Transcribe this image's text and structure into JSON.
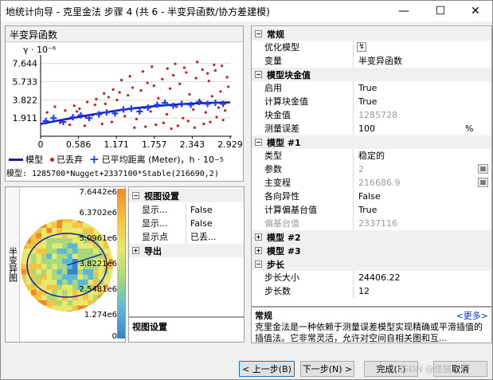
{
  "window": {
    "title": "地统计向导 - 克里金法 步骤 4 (共 6 - 半变异函数/协方差建模)",
    "minimize_glyph": "—",
    "maximize_glyph": "☐",
    "close_glyph": "✕"
  },
  "semivariogram": {
    "header": "半变异函数",
    "y_unit": "γ  · 10⁻⁶",
    "x_unit_suffix": "−5",
    "legend": {
      "model": "模型",
      "discarded": "已丢弃",
      "averaged": "已平均",
      "distance": "距离 (Meter)，h  · 10"
    },
    "model_text": "模型: 1285700*Nugget+2337100*Stable(216690,2)"
  },
  "chart_data": {
    "type": "scatter",
    "title": "",
    "xlabel": "",
    "ylabel": "",
    "xlim": [
      0,
      2.929
    ],
    "ylim": [
      0,
      8.2
    ],
    "x_ticks": [
      "0",
      "0.586",
      "1.171",
      "1.757",
      "2.343",
      "2.929"
    ],
    "y_ticks": [
      "1.911",
      "3.822",
      "5.733",
      "7.644"
    ],
    "series": [
      {
        "name": "已平均",
        "x": [
          0.08,
          0.2,
          0.35,
          0.5,
          0.62,
          0.75,
          0.9,
          1.02,
          1.15,
          1.28,
          1.4,
          1.53,
          1.66,
          1.8,
          1.92,
          2.05,
          2.18,
          2.32,
          2.45,
          2.58,
          2.7,
          2.82
        ],
        "y": [
          1.6,
          1.9,
          1.5,
          2.0,
          2.2,
          1.9,
          2.3,
          2.5,
          2.4,
          2.8,
          2.9,
          2.6,
          3.0,
          3.3,
          3.5,
          3.2,
          3.4,
          3.3,
          3.6,
          3.4,
          3.5,
          3.4
        ]
      },
      {
        "name": "模型",
        "x": [
          0,
          0.29,
          0.59,
          0.88,
          1.17,
          1.46,
          1.76,
          2.05,
          2.34,
          2.64,
          2.929
        ],
        "y": [
          1.29,
          1.66,
          2.03,
          2.38,
          2.69,
          2.95,
          3.16,
          3.32,
          3.43,
          3.51,
          3.56
        ]
      },
      {
        "name": "已丢弃",
        "x": [
          0.1,
          0.22,
          0.3,
          0.38,
          0.45,
          0.52,
          0.6,
          0.68,
          0.72,
          0.8,
          0.86,
          0.95,
          1.0,
          1.05,
          1.1,
          1.18,
          1.22,
          1.3,
          1.35,
          1.42,
          1.48,
          1.55,
          1.6,
          1.65,
          1.7,
          1.75,
          1.82,
          1.88,
          1.95,
          2.0,
          2.05,
          2.1,
          2.15,
          2.2,
          2.25,
          2.3,
          2.36,
          2.4,
          2.46,
          2.5,
          2.55,
          2.6,
          2.65,
          2.7,
          2.75,
          2.8,
          2.85,
          2.9,
          1.45,
          1.62,
          1.78,
          1.9,
          2.02,
          2.12,
          2.28,
          2.38,
          2.52,
          2.62,
          2.72,
          2.82,
          1.25,
          1.12,
          0.98,
          0.84,
          0.7,
          0.56,
          1.38,
          1.58,
          1.72,
          1.96,
          2.08,
          2.22,
          2.42,
          2.58,
          2.68,
          2.78,
          2.88
        ],
        "y": [
          2.5,
          3.1,
          1.4,
          2.7,
          1.2,
          3.2,
          2.9,
          1.1,
          3.6,
          2.2,
          3.9,
          1.3,
          3.4,
          4.1,
          1.5,
          3.8,
          4.6,
          2.1,
          4.3,
          5.1,
          1.8,
          4.8,
          3.0,
          5.6,
          2.6,
          5.3,
          4.0,
          6.0,
          2.3,
          5.0,
          6.4,
          3.1,
          5.5,
          1.9,
          6.7,
          4.4,
          2.8,
          6.1,
          3.7,
          7.0,
          2.5,
          5.8,
          4.2,
          6.9,
          3.0,
          7.4,
          2.7,
          5.2,
          0.9,
          1.0,
          1.2,
          1.4,
          0.8,
          1.1,
          1.6,
          0.9,
          1.3,
          1.5,
          2.0,
          1.7,
          5.9,
          4.9,
          4.5,
          3.3,
          2.0,
          2.6,
          6.3,
          6.8,
          7.3,
          7.1,
          7.6,
          7.2,
          7.8,
          6.6,
          7.5,
          4.7,
          6.2
        ]
      }
    ],
    "colors": {
      "model": "#1a1aa6",
      "averaged": "#1a3cff",
      "discarded": "#cc1a1a"
    }
  },
  "map": {
    "side_label": "半变异图",
    "colorbar_labels": [
      "7.6442e6",
      "6.3702e6",
      "5.0961e6",
      "3.8221e6",
      "2.5481e6",
      "1.274e6",
      "0"
    ]
  },
  "view_props": {
    "category": "视图设置",
    "rows": [
      {
        "name": "显示...",
        "value": "False"
      },
      {
        "name": "显示...",
        "value": "False"
      },
      {
        "name": "显示点",
        "value": "已丢..."
      }
    ],
    "export_category": "导出",
    "description_title": "视图设置"
  },
  "props": {
    "rows": [
      {
        "kind": "cat",
        "name": "常规",
        "expander": "−"
      },
      {
        "kind": "row",
        "name": "优化模型",
        "value": "",
        "icon": "optimize-icon"
      },
      {
        "kind": "row",
        "name": "变量",
        "value": "半变异函数"
      },
      {
        "kind": "cat",
        "name": "模型块金值",
        "expander": "−"
      },
      {
        "kind": "row",
        "name": "启用",
        "value": "True"
      },
      {
        "kind": "row",
        "name": "计算块金值",
        "value": "True"
      },
      {
        "kind": "row",
        "name": "块金值",
        "value": "1285728",
        "disabled": true
      },
      {
        "kind": "row",
        "name": "测量误差",
        "value": "100",
        "unit": "%"
      },
      {
        "kind": "cat",
        "name": "模型 #1",
        "expander": "−"
      },
      {
        "kind": "row",
        "name": "类型",
        "value": "稳定的"
      },
      {
        "kind": "row",
        "name": "参数",
        "value": "2",
        "disabled": true,
        "calc": true
      },
      {
        "kind": "row",
        "name": "主变程",
        "value": "216686.9",
        "disabled": true,
        "calc": true
      },
      {
        "kind": "row",
        "name": "各向异性",
        "value": "False"
      },
      {
        "kind": "row",
        "name": "计算偏基台值",
        "value": "True"
      },
      {
        "kind": "row",
        "name": "偏基台值",
        "value": "2337116",
        "disabled": true,
        "name_disabled": true
      },
      {
        "kind": "cat",
        "name": "模型 #2",
        "expander": "+"
      },
      {
        "kind": "cat",
        "name": "模型 #3",
        "expander": "+"
      },
      {
        "kind": "cat",
        "name": "步长",
        "expander": "−"
      },
      {
        "kind": "row",
        "name": "步长大小",
        "value": "24406.22"
      },
      {
        "kind": "row",
        "name": "步长数",
        "value": "12"
      }
    ],
    "description": {
      "title": "常规",
      "more": "<更多>",
      "text": "克里金法是一种依赖于测量误差模型实现精确或平滑插值的插值法。它非常灵活，允许对空间自相关图和互..."
    }
  },
  "buttons": {
    "back": "< 上一步(B)",
    "next": "下一步(N) >",
    "finish": "完成(F)",
    "cancel": "取消"
  },
  "watermark": "CSDN @怪猿"
}
